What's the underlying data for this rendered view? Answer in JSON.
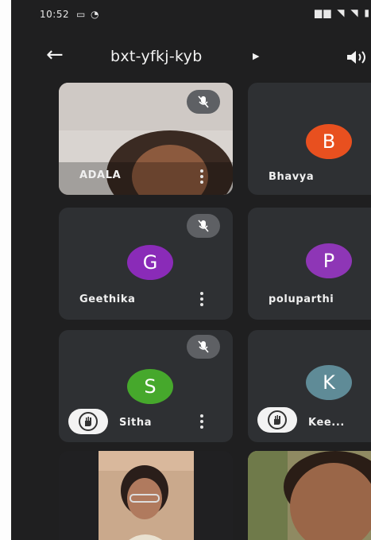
{
  "status_bar": {
    "time": "10:52"
  },
  "meeting": {
    "title": "bxt-yfkj-kyb"
  },
  "participants": [
    {
      "name": "ADALA",
      "initial": "",
      "color": "",
      "muted": true,
      "hand_raised": false
    },
    {
      "name": "Bhavya",
      "initial": "B",
      "color": "#e8501f",
      "muted": false,
      "hand_raised": false
    },
    {
      "name": "Geethika",
      "initial": "G",
      "color": "#8a2bb8",
      "muted": true,
      "hand_raised": false
    },
    {
      "name": "poluparthi",
      "initial": "P",
      "color": "#8e36b6",
      "muted": false,
      "hand_raised": false
    },
    {
      "name": "Sitha",
      "initial": "S",
      "color": "#46a82c",
      "muted": true,
      "hand_raised": true
    },
    {
      "name": "Kee...",
      "initial": "K",
      "color": "#5f8b97",
      "muted": false,
      "hand_raised": true
    }
  ],
  "colors": {
    "background": "#1f1f20",
    "tile": "#2e3033"
  }
}
